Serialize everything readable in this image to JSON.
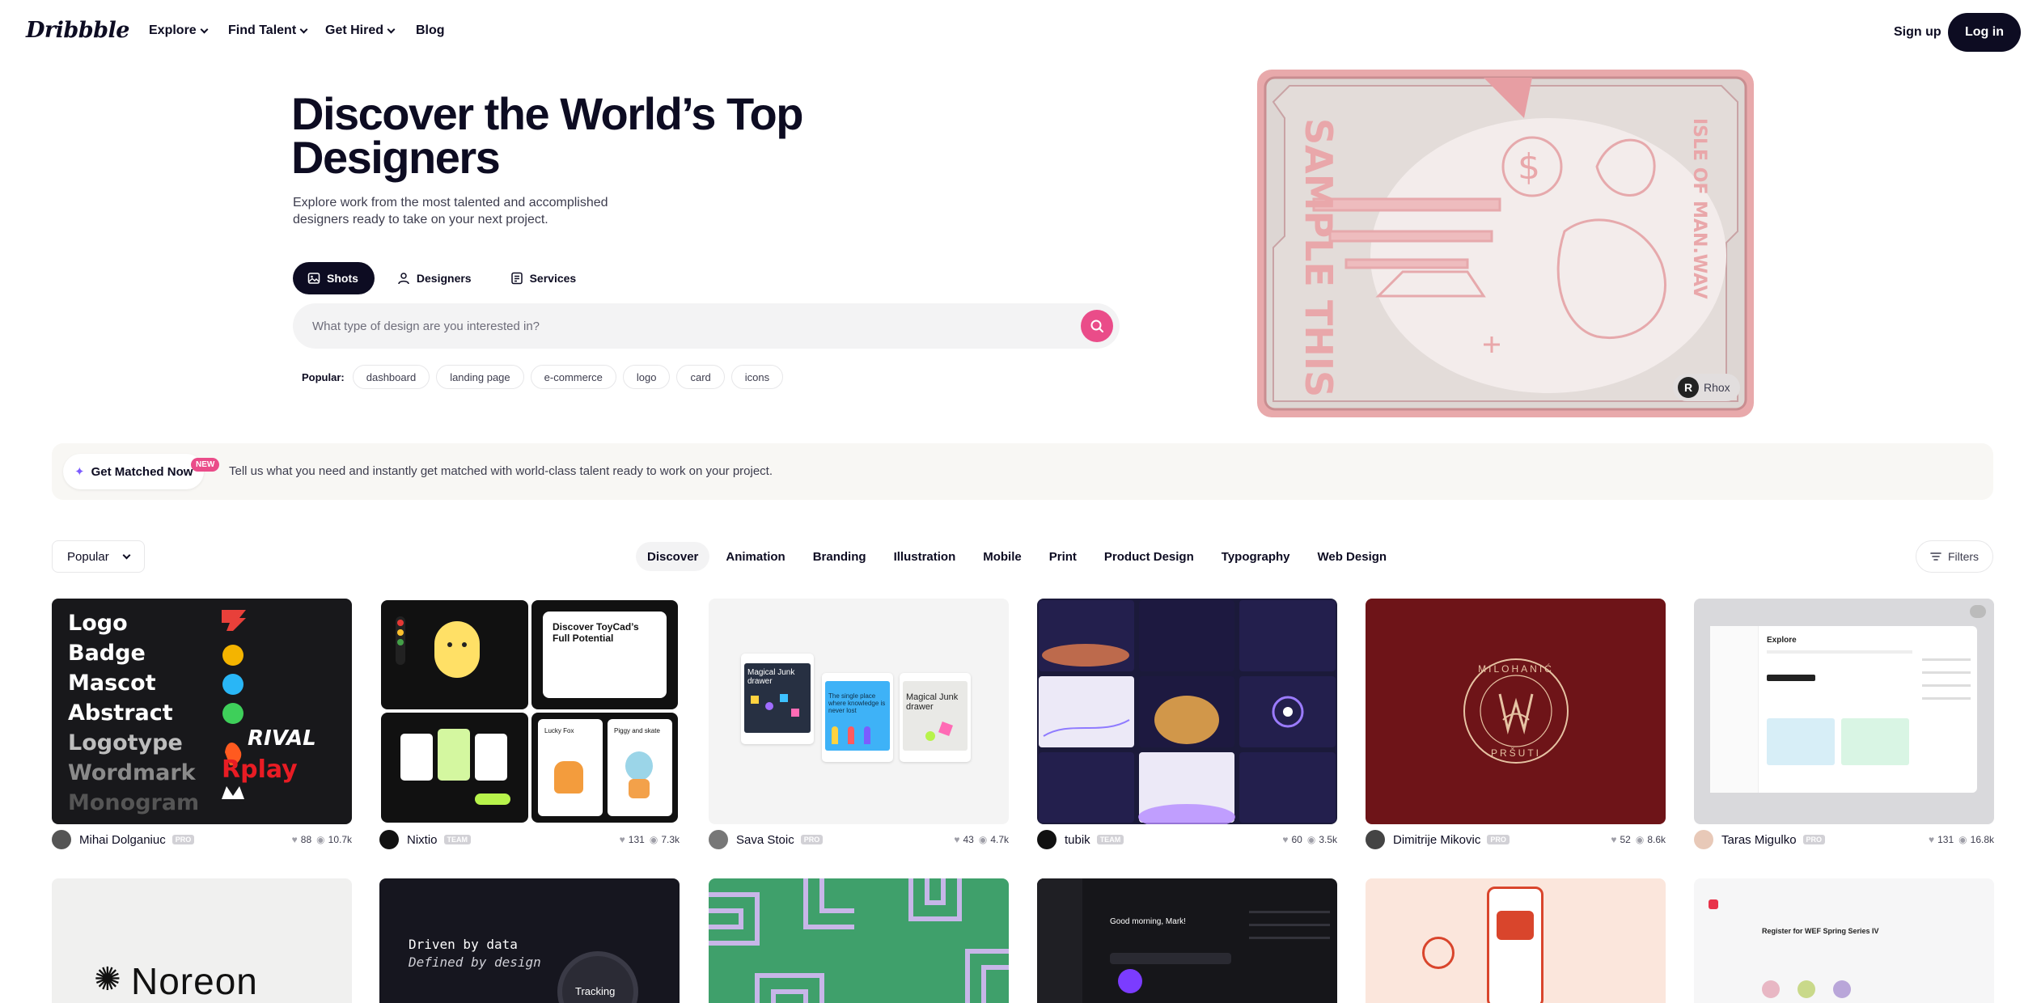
{
  "nav": {
    "logo": "Dribbble",
    "links": [
      "Explore",
      "Find Talent",
      "Get Hired",
      "Blog"
    ],
    "signup": "Sign up",
    "login": "Log in"
  },
  "hero": {
    "title": "Discover the World’s Top Designers",
    "subtitle": "Explore work from the most talented and accomplished designers ready to take on your next project.",
    "tabs": [
      "Shots",
      "Designers",
      "Services"
    ],
    "search_placeholder": "What type of design are you interested in?",
    "popular_label": "Popular:",
    "popular_tags": [
      "dashboard",
      "landing page",
      "e-commerce",
      "logo",
      "card",
      "icons"
    ],
    "art_text": "SAMPLE THIS",
    "art_side_text": "ISLE OF MAN.WAV",
    "art_credit": "Rhox"
  },
  "banner": {
    "button": "Get Matched Now",
    "badge": "NEW",
    "text": "Tell us what you need and instantly get matched with world-class talent ready to work on your project."
  },
  "filters": {
    "sort": "Popular",
    "categories": [
      "Discover",
      "Animation",
      "Branding",
      "Illustration",
      "Mobile",
      "Print",
      "Product Design",
      "Typography",
      "Web Design"
    ],
    "filters_label": "Filters"
  },
  "shots": [
    {
      "author": "Mihai Dolganiuc",
      "badge": "PRO",
      "likes": "88",
      "views": "10.7k"
    },
    {
      "author": "Nixtio",
      "badge": "TEAM",
      "likes": "131",
      "views": "7.3k"
    },
    {
      "author": "Sava Stoic",
      "badge": "PRO",
      "likes": "43",
      "views": "4.7k"
    },
    {
      "author": "tubik",
      "badge": "TEAM",
      "likes": "60",
      "views": "3.5k"
    },
    {
      "author": "Dimitrije Mikovic",
      "badge": "PRO",
      "likes": "52",
      "views": "8.6k"
    },
    {
      "author": "Taras Migulko",
      "badge": "PRO",
      "likes": "131",
      "views": "16.8k"
    }
  ],
  "shot_art": {
    "logo_words": [
      "Logo",
      "Badge",
      "Mascot",
      "Abstract",
      "Logotype",
      "Wordmark",
      "Monogram"
    ],
    "logo_brands": [
      "RIVAL",
      "Rplay"
    ],
    "toycad_title": "Discover ToyCad’s Full Potential",
    "toycad_cards": [
      "Lucky Fox",
      "Piggy and skate"
    ],
    "junk_cards": [
      "Magical Junk drawer",
      "The single place where knowledge is never lost",
      "Magical Junk drawer"
    ],
    "seal_top": "MILOHANIĆ",
    "seal_bottom": "PRŠUTI",
    "explore_title": "Explore",
    "row2_noreon": "Noreon",
    "row2_driven": "Driven by data",
    "row2_defined": "Defined by design",
    "row2_tracking": "Tracking",
    "row2_morning": "Good morning, Mark!",
    "row2_register": "Register for WEF Spring Series IV"
  }
}
